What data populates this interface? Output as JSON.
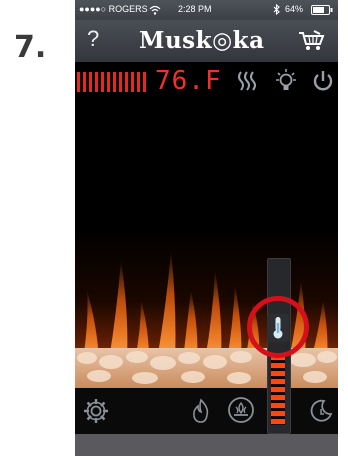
{
  "step_label": "7.",
  "status_bar": {
    "carrier": "●●●●○ ROGERS",
    "time": "2:28 PM",
    "battery": "64%",
    "icons": [
      "wifi-icon",
      "bluetooth-icon",
      "battery-icon"
    ]
  },
  "nav_bar": {
    "help_label": "?",
    "brand": "Musk◎ka",
    "icons": [
      "cart-icon"
    ]
  },
  "temperature": {
    "readout": "76.F",
    "icons": [
      "heat-bars-icon",
      "heat-waves-icon",
      "light-bulb-icon",
      "power-icon"
    ],
    "slider_level_percent": 60
  },
  "bottom_bar": {
    "icons": [
      "settings-gear-icon",
      "flame-icon",
      "ember-bed-icon",
      "timer-moon-icon"
    ]
  },
  "colors": {
    "accent_red": "#f2302a",
    "highlight_ring": "#d4101a",
    "nav_bg": "#3c4046"
  }
}
